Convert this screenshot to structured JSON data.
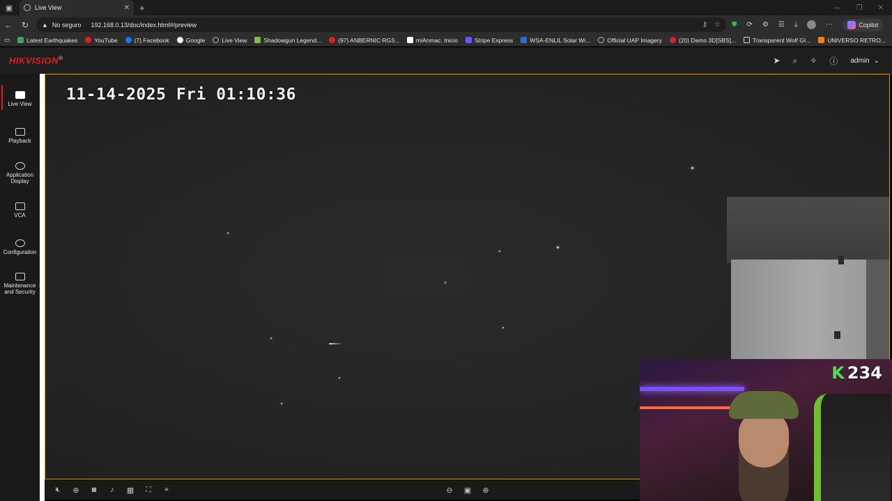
{
  "browser": {
    "tab_title": "Live View",
    "address_warning": "No seguro",
    "url": "192.168.0.13/doc/index.html#/preview",
    "copilot_label": "Copilot"
  },
  "bookmarks": [
    {
      "label": "Latest Earthquakes",
      "color": "#3aa65a"
    },
    {
      "label": "YouTube",
      "color": "#e02020"
    },
    {
      "label": "(7) Facebook",
      "color": "#1877f2"
    },
    {
      "label": "Google",
      "color": "#ffffff"
    },
    {
      "label": "Live View",
      "color": "#bbbbbb"
    },
    {
      "label": "Shadowgun Legend...",
      "color": "#7cc242"
    },
    {
      "label": "(97) ANBERNIC RG3...",
      "color": "#e02020"
    },
    {
      "label": "miAnmac. Inicio",
      "color": "#ffffff"
    },
    {
      "label": "Stripe Express",
      "color": "#635bff"
    },
    {
      "label": "WSA-ENLIL Solar Wi...",
      "color": "#2a6fd6"
    },
    {
      "label": "Official UAP Imagery",
      "color": "#bbbbbb"
    },
    {
      "label": "(20) Demo 3D[SBS]...",
      "color": "#e02020"
    },
    {
      "label": "Transparent Wolf GI...",
      "color": "#dddddd"
    },
    {
      "label": "UNIVERSO RETRO...",
      "color": "#ff7a1a"
    }
  ],
  "app": {
    "logo": "HIKVISION",
    "logo_mark": "®",
    "user": "admin"
  },
  "sidebar": {
    "items": [
      {
        "label": "Live View"
      },
      {
        "label": "Playback"
      },
      {
        "label": "Application Display"
      },
      {
        "label": "VCA"
      },
      {
        "label": "Configuration"
      },
      {
        "label": "Maintenance and Security"
      }
    ]
  },
  "video": {
    "osd_timestamp": "11-14-2025 Fri 01:10:36"
  },
  "webcam": {
    "badge_letter": "K",
    "badge_number": "234"
  },
  "colors": {
    "brand": "#e02020",
    "video_border": "#c9a227",
    "badge_green": "#4be04b"
  }
}
